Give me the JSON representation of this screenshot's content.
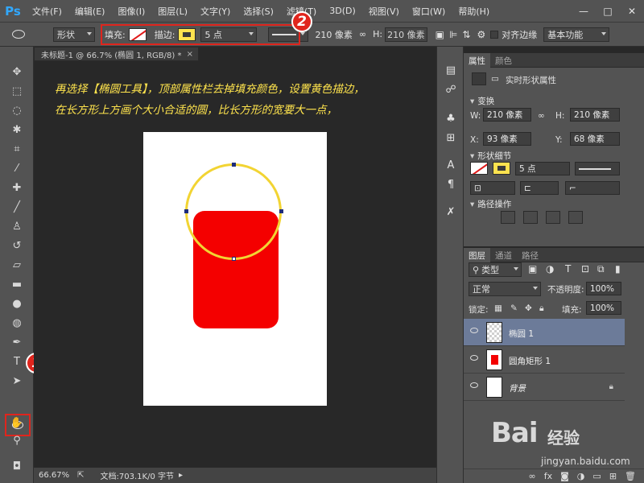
{
  "app": {
    "logo": "Ps"
  },
  "menu": [
    "文件(F)",
    "编辑(E)",
    "图像(I)",
    "图层(L)",
    "文字(Y)",
    "选择(S)",
    "滤镜(T)",
    "3D(D)",
    "视图(V)",
    "窗口(W)",
    "帮助(H)"
  ],
  "window_controls": [
    "—",
    "□",
    "✕"
  ],
  "options": {
    "mode": "形状",
    "fill_label": "填充:",
    "stroke_label": "描边:",
    "stroke_width": "5 点",
    "width_value": "210 像素",
    "height_label": "H:",
    "height_value": "210 像素",
    "align_edges_label": "对齐边缘",
    "workspace": "基本功能"
  },
  "badges": {
    "one": "1",
    "two": "2"
  },
  "colors": {
    "foreground": "#fde24f",
    "background": "#ffffff",
    "rect_fill": "#f40000",
    "circle_stroke": "#f2d433",
    "highlight": "#e0251d"
  },
  "document": {
    "tab_title": "未标题-1 @ 66.7% (椭圆 1, RGB/8) *",
    "close": "×",
    "instructions": [
      "再选择【椭圆工具】，顶部属性栏去掉填充颜色，设置黄色描边，",
      "在长方形上方画个大小合适的圆，比长方形的宽要大一点，"
    ]
  },
  "status": {
    "zoom": "66.67%",
    "doc_info": "文档:703.1K/0 字节"
  },
  "properties": {
    "tabs": [
      "属性",
      "颜色"
    ],
    "title": "实时形状属性",
    "transform_head": "变换",
    "w_label": "W:",
    "w_value": "210 像素",
    "h_label": "H:",
    "h_value": "210 像素",
    "x_label": "X:",
    "x_value": "93 像素",
    "y_label": "Y:",
    "y_value": "68 像素",
    "shape_details_head": "形状细节",
    "stroke_width": "5 点",
    "path_ops_head": "路径操作"
  },
  "layers": {
    "tabs": [
      "图层",
      "通道",
      "路径"
    ],
    "kind_filter": "类型",
    "blend_mode": "正常",
    "opacity_label": "不透明度:",
    "opacity_value": "100%",
    "lock_label": "锁定:",
    "fill_label": "填充:",
    "fill_value": "100%",
    "items": [
      {
        "name": "椭圆 1",
        "selected": true
      },
      {
        "name": "圆角矩形 1",
        "selected": false
      },
      {
        "name": "背景",
        "selected": false
      }
    ]
  },
  "watermark": {
    "brand": "Bai",
    "brand2": "经验",
    "url": "jingyan.baidu.com"
  }
}
